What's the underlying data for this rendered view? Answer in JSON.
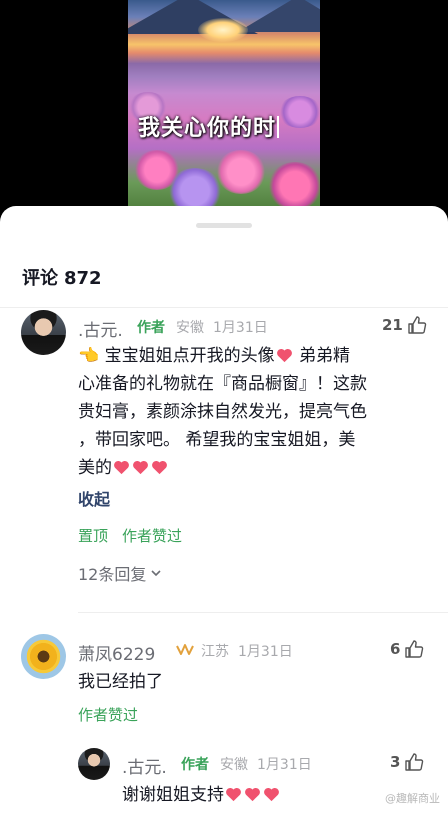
{
  "video": {
    "caption": "我关心你的时"
  },
  "comments_header": {
    "label": "评论",
    "count": "872"
  },
  "comment1": {
    "author": ".古元.",
    "author_tag": "作者",
    "location": "安徽",
    "date": "1月31日",
    "likes": "21",
    "line1": "👈 宝宝姐姐点开我的头像",
    "line1b": "  弟弟精",
    "line2": "心准备的礼物就在『商品橱窗』！这款",
    "line3": "贵妇膏，素颜涂抹自然发光，提亮气色",
    "line4": "，带回家吧。  希望我的宝宝姐姐，美",
    "line5": "美的",
    "collapse_label": "收起",
    "pinned_label": "置顶",
    "author_liked_label": "作者赞过",
    "replies_label": "12条回复"
  },
  "comment2": {
    "author": "萧凤6229",
    "location": "江苏",
    "date": "1月31日",
    "likes": "6",
    "text": "我已经拍了",
    "author_liked_label": "作者赞过"
  },
  "reply1": {
    "author": ".古元.",
    "author_tag": "作者",
    "location": "安徽",
    "date": "1月31日",
    "likes": "3",
    "text": "谢谢姐姐支持"
  },
  "watermark": "@趣解商业",
  "colors": {
    "accent_green": "#3aa35a",
    "heart": "#f0526e",
    "link": "#31456b"
  }
}
